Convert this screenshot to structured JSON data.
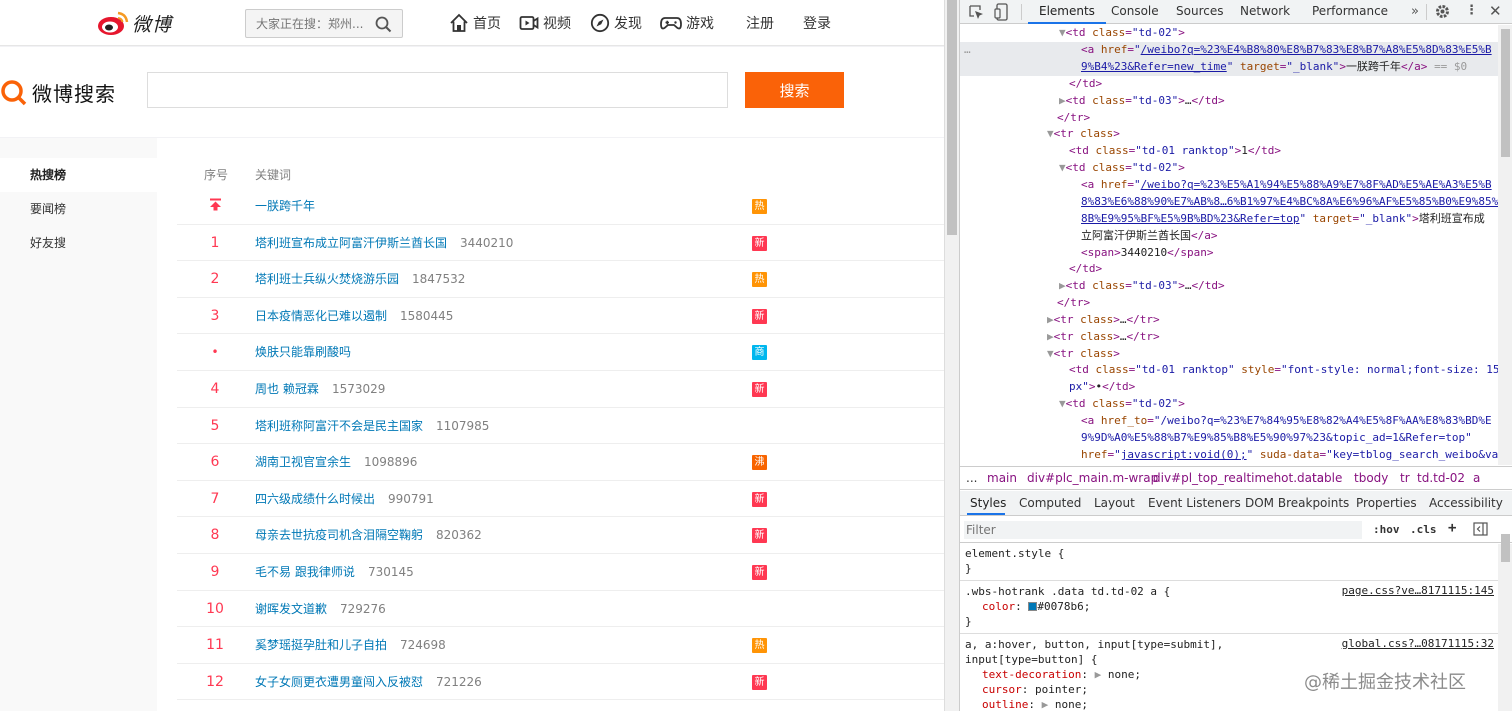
{
  "weibo": {
    "logo_text": "微博",
    "top_search_placeholder": "大家正在搜：郑州...",
    "nav": [
      "首页",
      "视频",
      "发现",
      "游戏",
      "注册",
      "登录"
    ],
    "search_logo_text": "微博搜索",
    "search_button": "搜索",
    "sidebar": [
      "热搜榜",
      "要闻榜",
      "好友搜"
    ],
    "col_rank": "序号",
    "col_keyword": "关键词",
    "rows": [
      {
        "rank": "",
        "top": true,
        "keyword": "一朕跨千年",
        "count": "",
        "badge": "热",
        "badge_color": "#ff9406"
      },
      {
        "rank": "1",
        "keyword": "塔利班宣布成立阿富汗伊斯兰酋长国",
        "count": "3440210",
        "badge": "新",
        "badge_color": "#ff3852"
      },
      {
        "rank": "2",
        "keyword": "塔利班士兵纵火焚烧游乐园",
        "count": "1847532",
        "badge": "热",
        "badge_color": "#ff9406"
      },
      {
        "rank": "3",
        "keyword": "日本疫情恶化已难以遏制",
        "count": "1580445",
        "badge": "新",
        "badge_color": "#ff3852"
      },
      {
        "rank": "•",
        "keyword": "焕肤只能靠刷酸吗",
        "count": "",
        "badge": "商",
        "badge_color": "#00b7ee"
      },
      {
        "rank": "4",
        "keyword": "周也 赖冠霖",
        "count": "1573029",
        "badge": "新",
        "badge_color": "#ff3852"
      },
      {
        "rank": "5",
        "keyword": "塔利班称阿富汗不会是民主国家",
        "count": "1107985",
        "badge": "",
        "badge_color": ""
      },
      {
        "rank": "6",
        "keyword": "湖南卫视官宣余生",
        "count": "1098896",
        "badge": "沸",
        "badge_color": "#f86400"
      },
      {
        "rank": "7",
        "keyword": "四六级成绩什么时候出",
        "count": "990791",
        "badge": "新",
        "badge_color": "#ff3852"
      },
      {
        "rank": "8",
        "keyword": "母亲去世抗疫司机含泪隔空鞠躬",
        "count": "820362",
        "badge": "新",
        "badge_color": "#ff3852"
      },
      {
        "rank": "9",
        "keyword": "毛不易 跟我律师说",
        "count": "730145",
        "badge": "新",
        "badge_color": "#ff3852"
      },
      {
        "rank": "10",
        "keyword": "谢晖发文道歉",
        "count": "729276",
        "badge": "",
        "badge_color": ""
      },
      {
        "rank": "11",
        "keyword": "奚梦瑶挺孕肚和儿子自拍",
        "count": "724698",
        "badge": "热",
        "badge_color": "#ff9406"
      },
      {
        "rank": "12",
        "keyword": "女子女厕更衣遭男童闯入反被怼",
        "count": "721226",
        "badge": "新",
        "badge_color": "#ff3852"
      }
    ]
  },
  "devtools": {
    "tabs": [
      "Elements",
      "Console",
      "Sources",
      "Network",
      "Performance"
    ],
    "breadcrumbs": [
      "...",
      "main",
      "div#plc_main.m-wrap",
      "div#pl_top_realtimehot.data",
      "table",
      "tbody",
      "tr",
      "td.td-02",
      "a"
    ],
    "style_tabs": [
      "Styles",
      "Computed",
      "Layout",
      "Event Listeners",
      "DOM Breakpoints",
      "Properties",
      "Accessibility"
    ],
    "filter_placeholder": "Filter",
    "hov": ":hov",
    "cls": ".cls",
    "plus": "+",
    "rule1_selector": "element.style {",
    "rule1_close": "}",
    "rule2_selector": ".wbs-hotrank .data td.td-02 a {",
    "rule2_source": "page.css?ve…8171115:145",
    "rule2_prop": "color",
    "rule2_value": "#0078b6;",
    "rule2_close": "}",
    "rule3_selector_1": "a, a:hover, button, input[type=submit],",
    "rule3_selector_2": "input[type=button] {",
    "rule3_source": "global.css?…08171115:32",
    "rule3_props": [
      {
        "name": "text-decoration",
        "value": "none;"
      },
      {
        "name": "cursor",
        "value": "pointer;"
      },
      {
        "name": "outline",
        "value": "none;"
      }
    ],
    "watermark": "@稀土掘金技术社区"
  }
}
